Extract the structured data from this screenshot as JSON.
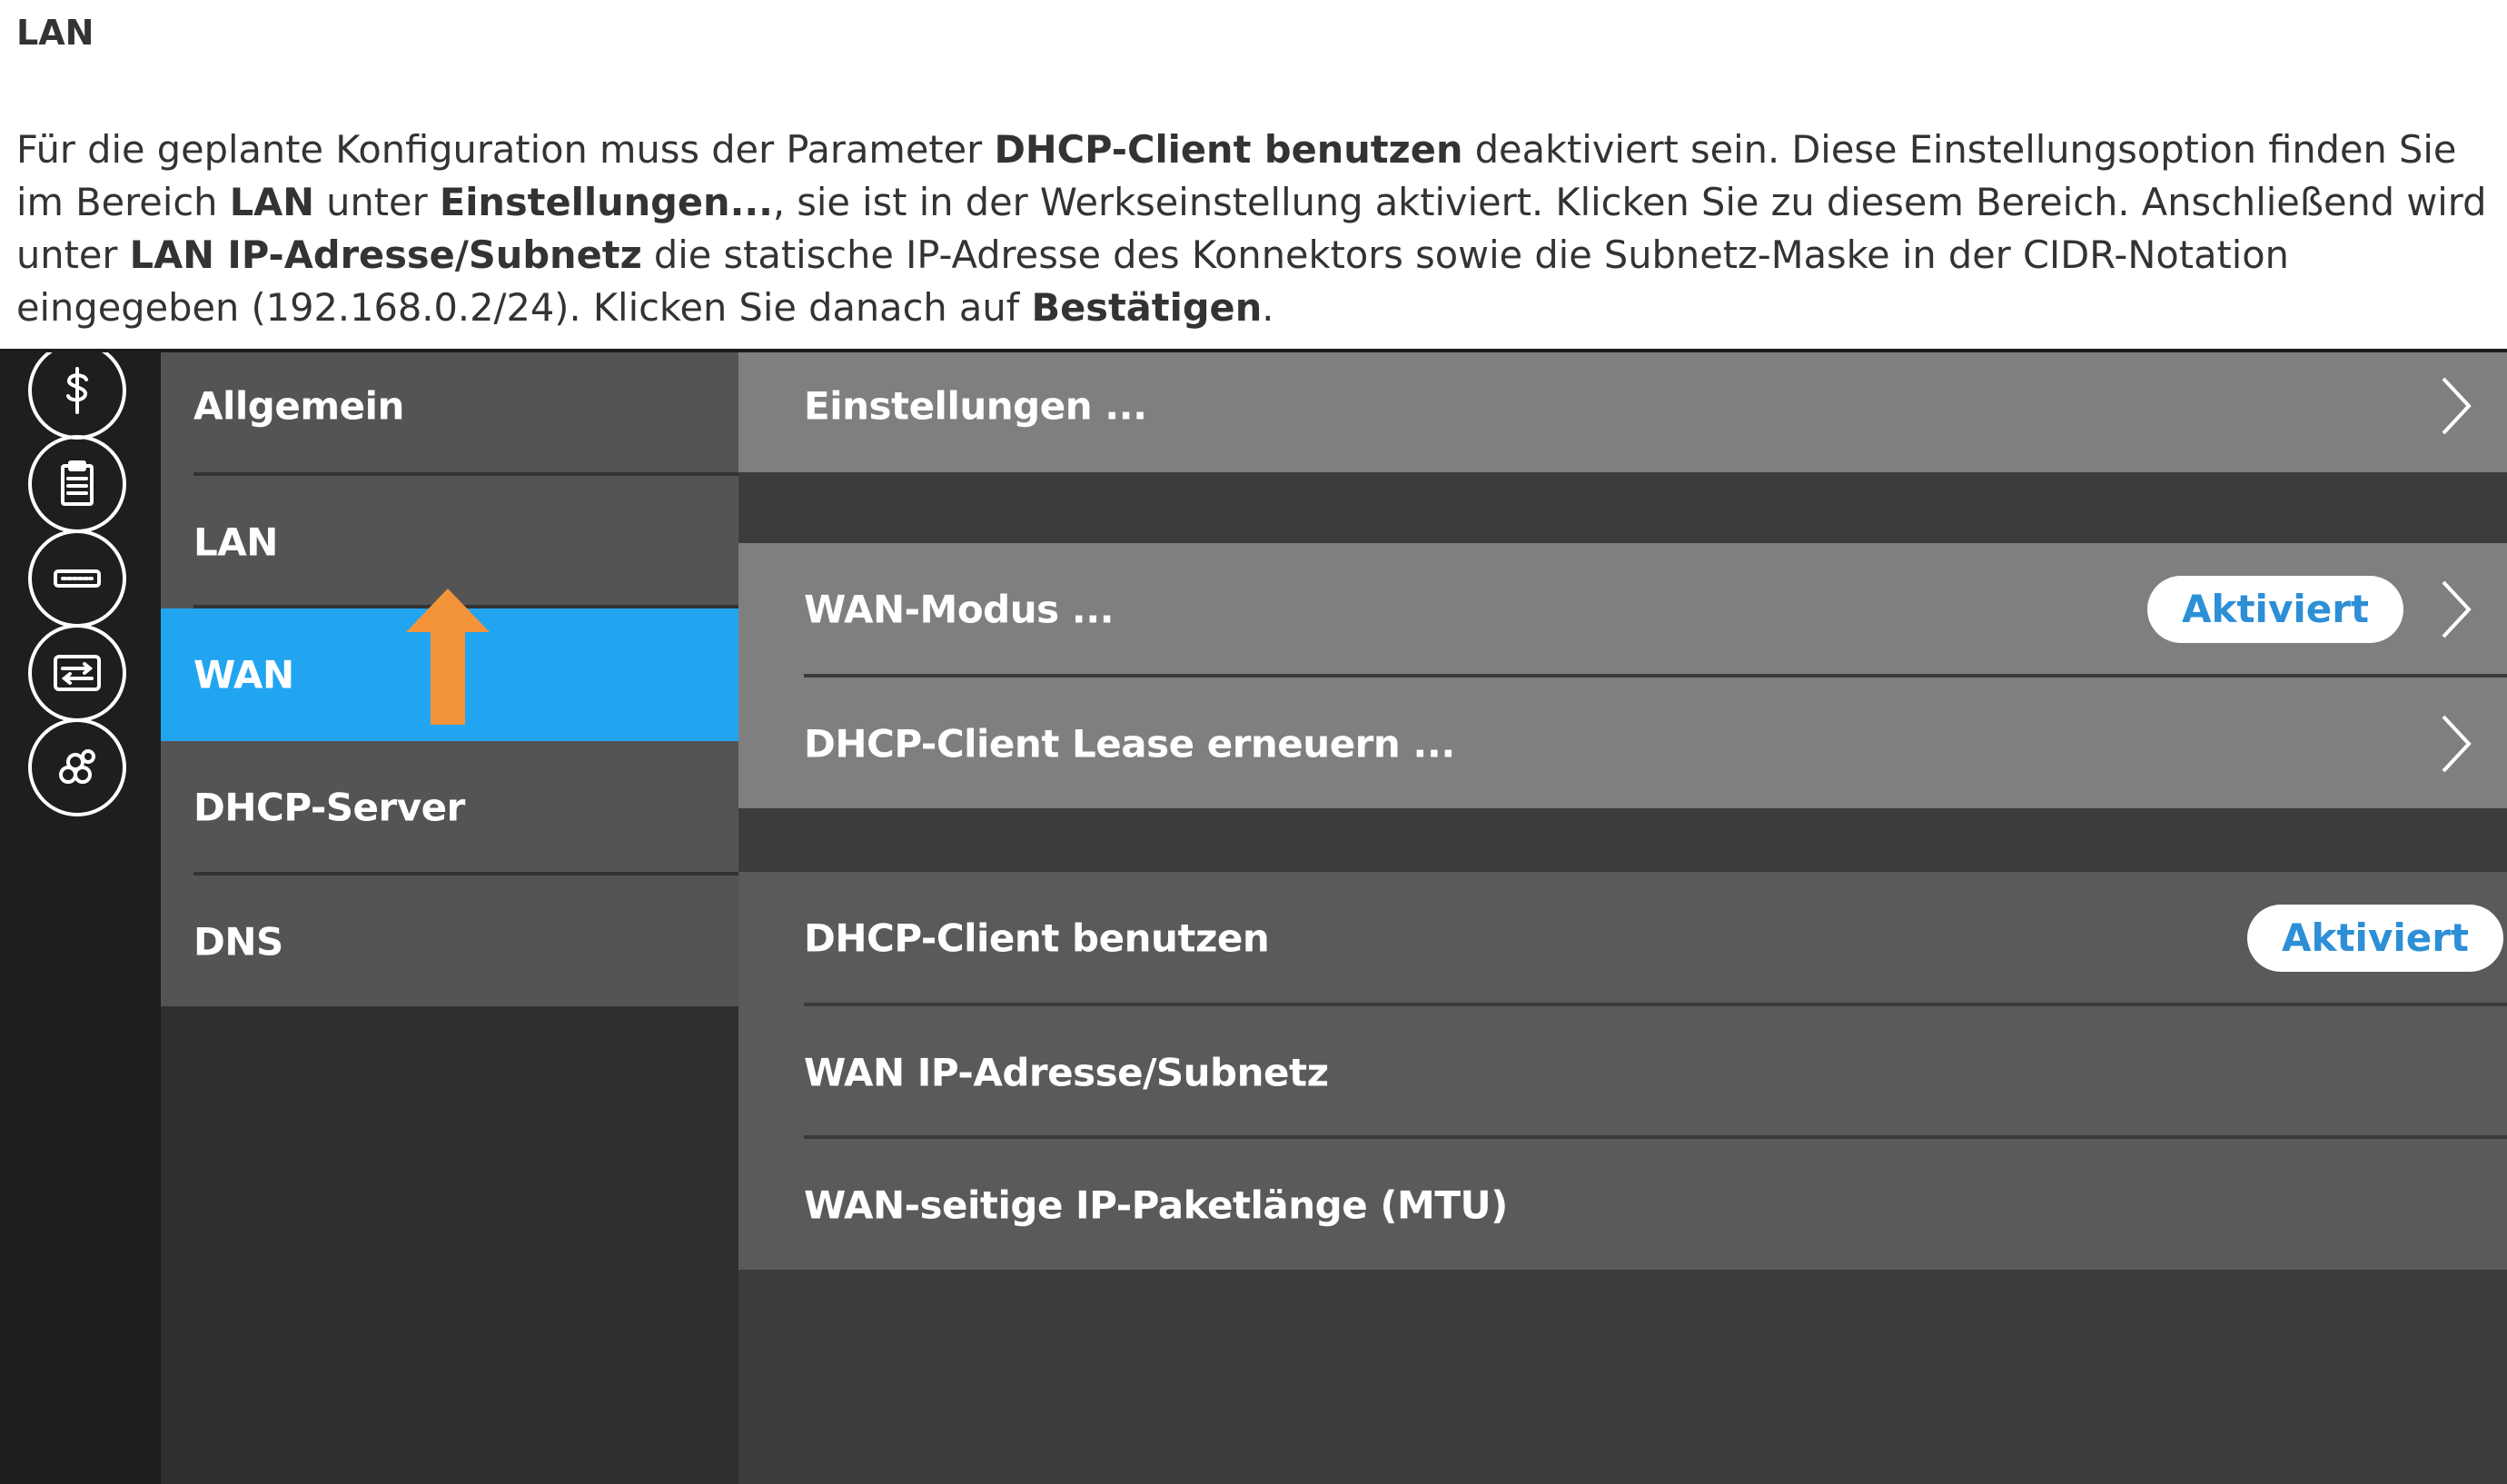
{
  "document": {
    "heading": "LAN",
    "paragraph": [
      {
        "text": "Für die geplante Konfiguration muss der Parameter ",
        "bold": false
      },
      {
        "text": "DHCP-Client benutzen",
        "bold": true
      },
      {
        "text": " deaktiviert sein. Diese Einstellungsoption finden Sie im Bereich ",
        "bold": false
      },
      {
        "text": "LAN",
        "bold": true
      },
      {
        "text": " unter ",
        "bold": false
      },
      {
        "text": "Einstellungen...",
        "bold": true
      },
      {
        "text": ", sie ist in der Werkseinstellung aktiviert. Klicken Sie zu diesem Bereich. Anschließend wird unter ",
        "bold": false
      },
      {
        "text": "LAN IP-Adresse/Subnetz",
        "bold": true
      },
      {
        "text": " die statische IP-Adresse des Konnektors sowie die Subnetz-Maske in der CIDR-Notation eingegeben (192.168.0.2/24). Klicken Sie danach auf ",
        "bold": false
      },
      {
        "text": "Bestätigen",
        "bold": true
      },
      {
        "text": ".",
        "bold": false
      }
    ]
  },
  "iconbar": {
    "icons": [
      {
        "name": "dollar-icon"
      },
      {
        "name": "clipboard-icon"
      },
      {
        "name": "connector-icon"
      },
      {
        "name": "transfer-icon"
      },
      {
        "name": "network-nodes-icon"
      }
    ]
  },
  "menu": {
    "items": [
      {
        "label": "Allgemein",
        "active": false
      },
      {
        "label": "LAN",
        "active": false
      },
      {
        "label": "WAN",
        "active": true
      },
      {
        "label": "DHCP-Server",
        "active": false
      },
      {
        "label": "DNS",
        "active": false
      }
    ]
  },
  "annotation": {
    "arrow_color": "#f4943a"
  },
  "content": {
    "einstellungen_label": "Einstellungen ...",
    "wan_modus_label": "WAN-Modus ...",
    "wan_modus_badge": "Aktiviert",
    "dhcp_lease_label": "DHCP-Client Lease erneuern ...",
    "dhcp_client_label": "DHCP-Client benutzen",
    "dhcp_client_badge": "Aktiviert",
    "wan_ip_label": "WAN IP-Adresse/Subnetz",
    "mtu_label": "WAN-seitige IP-Paketlänge (MTU)"
  },
  "colors": {
    "accent": "#22a5f1",
    "badge_text": "#2d8fd6",
    "annotation_arrow": "#f4943a"
  }
}
